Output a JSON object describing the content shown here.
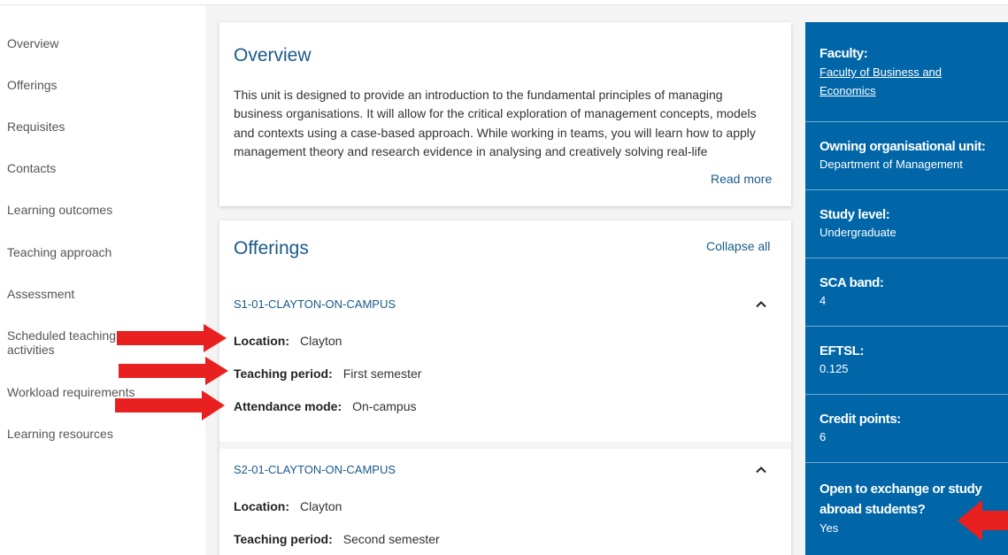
{
  "nav": {
    "items": [
      {
        "label": "Overview"
      },
      {
        "label": "Offerings"
      },
      {
        "label": "Requisites"
      },
      {
        "label": "Contacts"
      },
      {
        "label": "Learning outcomes"
      },
      {
        "label": "Teaching approach"
      },
      {
        "label": "Assessment"
      },
      {
        "label": "Scheduled teaching activities"
      },
      {
        "label": "Workload requirements"
      },
      {
        "label": "Learning resources"
      }
    ]
  },
  "overview": {
    "title": "Overview",
    "text": "This unit is designed to provide an introduction to the fundamental principles of managing business organisations. It will allow for the critical exploration of management concepts, models and contexts using a case-based approach. While working in teams, you will learn how to apply management theory and research evidence in analysing and creatively solving real-life",
    "read_more": "Read more"
  },
  "offerings": {
    "title": "Offerings",
    "collapse_all": "Collapse all",
    "items": [
      {
        "code": "S1-01-CLAYTON-ON-CAMPUS",
        "location_label": "Location:",
        "location": "Clayton",
        "period_label": "Teaching period:",
        "period": "First semester",
        "mode_label": "Attendance mode:",
        "mode": "On-campus"
      },
      {
        "code": "S2-01-CLAYTON-ON-CAMPUS",
        "location_label": "Location:",
        "location": "Clayton",
        "period_label": "Teaching period:",
        "period": "Second semester"
      }
    ]
  },
  "info": {
    "faculty_label": "Faculty:",
    "faculty_line1": "Faculty of Business and",
    "faculty_line2": "Economics",
    "owning_label": "Owning organisational unit:",
    "owning_value": "Department of Management",
    "level_label": "Study level:",
    "level_value": "Undergraduate",
    "sca_label": "SCA band:",
    "sca_value": "4",
    "eftsl_label": "EFTSL:",
    "eftsl_value": "0.125",
    "credit_label": "Credit points:",
    "credit_value": "6",
    "exchange_label_line1": "Open to exchange or study",
    "exchange_label_line2": "abroad students?",
    "exchange_value": "Yes"
  },
  "colors": {
    "accent": "#1a5a8a",
    "panel": "#0066a8",
    "annotation": "#e8201f"
  },
  "icons": {
    "chevron": "chevron-up-icon",
    "arrow": "red-arrow-icon"
  }
}
